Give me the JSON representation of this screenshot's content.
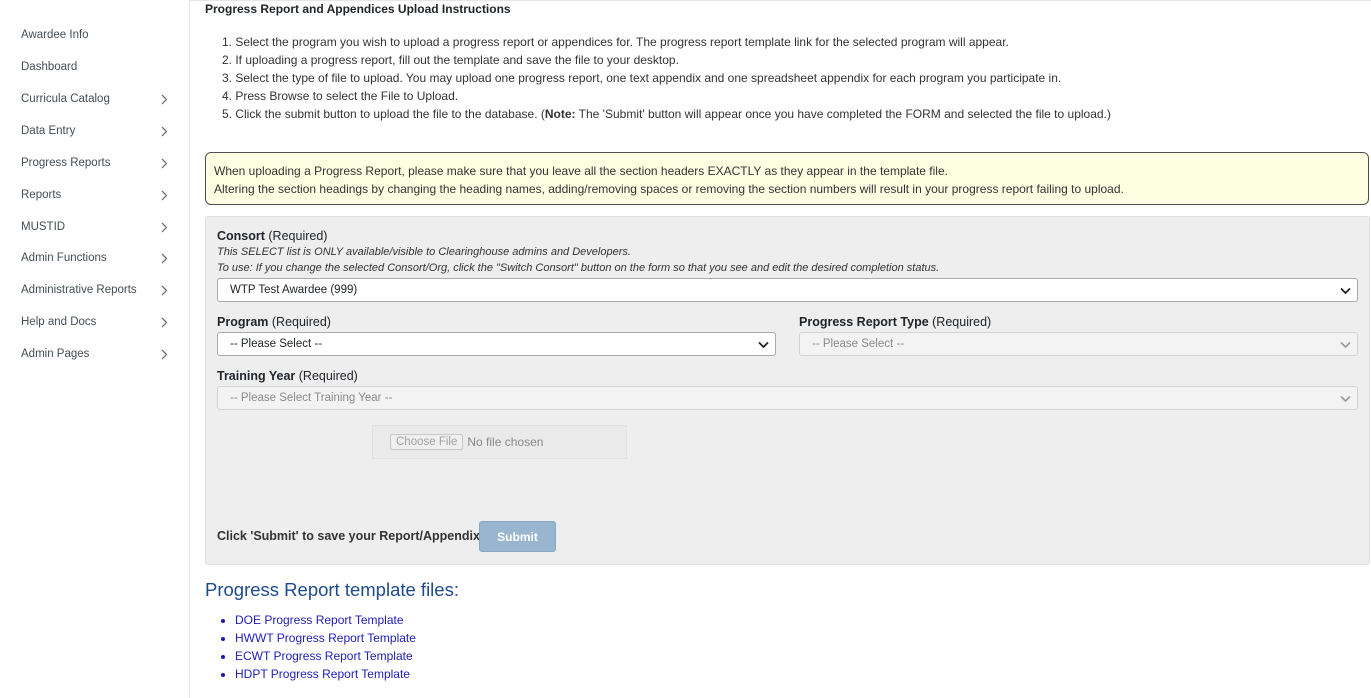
{
  "sidebar": {
    "items": [
      {
        "label": "Awardee Info",
        "has_children": false
      },
      {
        "label": "Dashboard",
        "has_children": false
      },
      {
        "label": "Curricula Catalog",
        "has_children": true
      },
      {
        "label": "Data Entry",
        "has_children": true
      },
      {
        "label": "Progress Reports",
        "has_children": true
      },
      {
        "label": "Reports",
        "has_children": true
      },
      {
        "label": "MUSTID",
        "has_children": true
      },
      {
        "label": "Admin Functions",
        "has_children": true
      },
      {
        "label": "Administrative Reports",
        "has_children": true
      },
      {
        "label": "Help and Docs",
        "has_children": true
      },
      {
        "label": "Admin Pages",
        "has_children": true
      }
    ]
  },
  "page": {
    "heading": "Progress Report and Appendices Upload Instructions",
    "steps": [
      "1. Select the program you wish to upload a progress report or appendices for. The progress report template link for the selected program will appear.",
      "2. If uploading a progress report, fill out the template and save the file to your desktop.",
      "3. Select the type of file to upload. You may upload one progress report, one text appendix and one spreadsheet appendix for each program you participate in.",
      "4. Press Browse to select the File to Upload.",
      "5. Click the submit button to upload the file to the database. ("
    ],
    "step5_note_label": "Note:",
    "step5_note_text": " The 'Submit' button will appear once you have completed the FORM and selected the file to upload.)",
    "notice_line1": "When uploading a Progress Report, please make sure that you leave all the section headers EXACTLY as they appear in the template file.",
    "notice_line2": "Altering the section headings by changing the heading names, adding/removing spaces or removing the section numbers will result in your progress report failing to upload."
  },
  "form": {
    "consort": {
      "label": "Consort",
      "required": " (Required)",
      "note1": "This SELECT list is ONLY available/visible to Clearinghouse admins and Developers.",
      "note2": "To use: If you change the selected Consort/Org, click the \"Switch Consort\" button on the form so that you see and edit the desired completion status.",
      "value": "WTP Test Awardee (999)"
    },
    "program": {
      "label": "Program",
      "required": " (Required)",
      "value": "-- Please Select --"
    },
    "report_type": {
      "label": "Progress Report Type",
      "required": " (Required)",
      "value": "-- Please Select --"
    },
    "training_year": {
      "label": "Training Year",
      "required": " (Required)",
      "value": "-- Please Select Training Year --"
    },
    "file": {
      "button_label": "Choose File",
      "status": "No file chosen"
    },
    "submit_prompt": "Click 'Submit' to save your Report/Appendix",
    "submit_label": "Submit"
  },
  "templates": {
    "title": "Progress Report template files:",
    "links": [
      "DOE Progress Report Template",
      "HWWT Progress Report Template",
      "ECWT Progress Report Template",
      "HDPT Progress Report Template"
    ]
  }
}
